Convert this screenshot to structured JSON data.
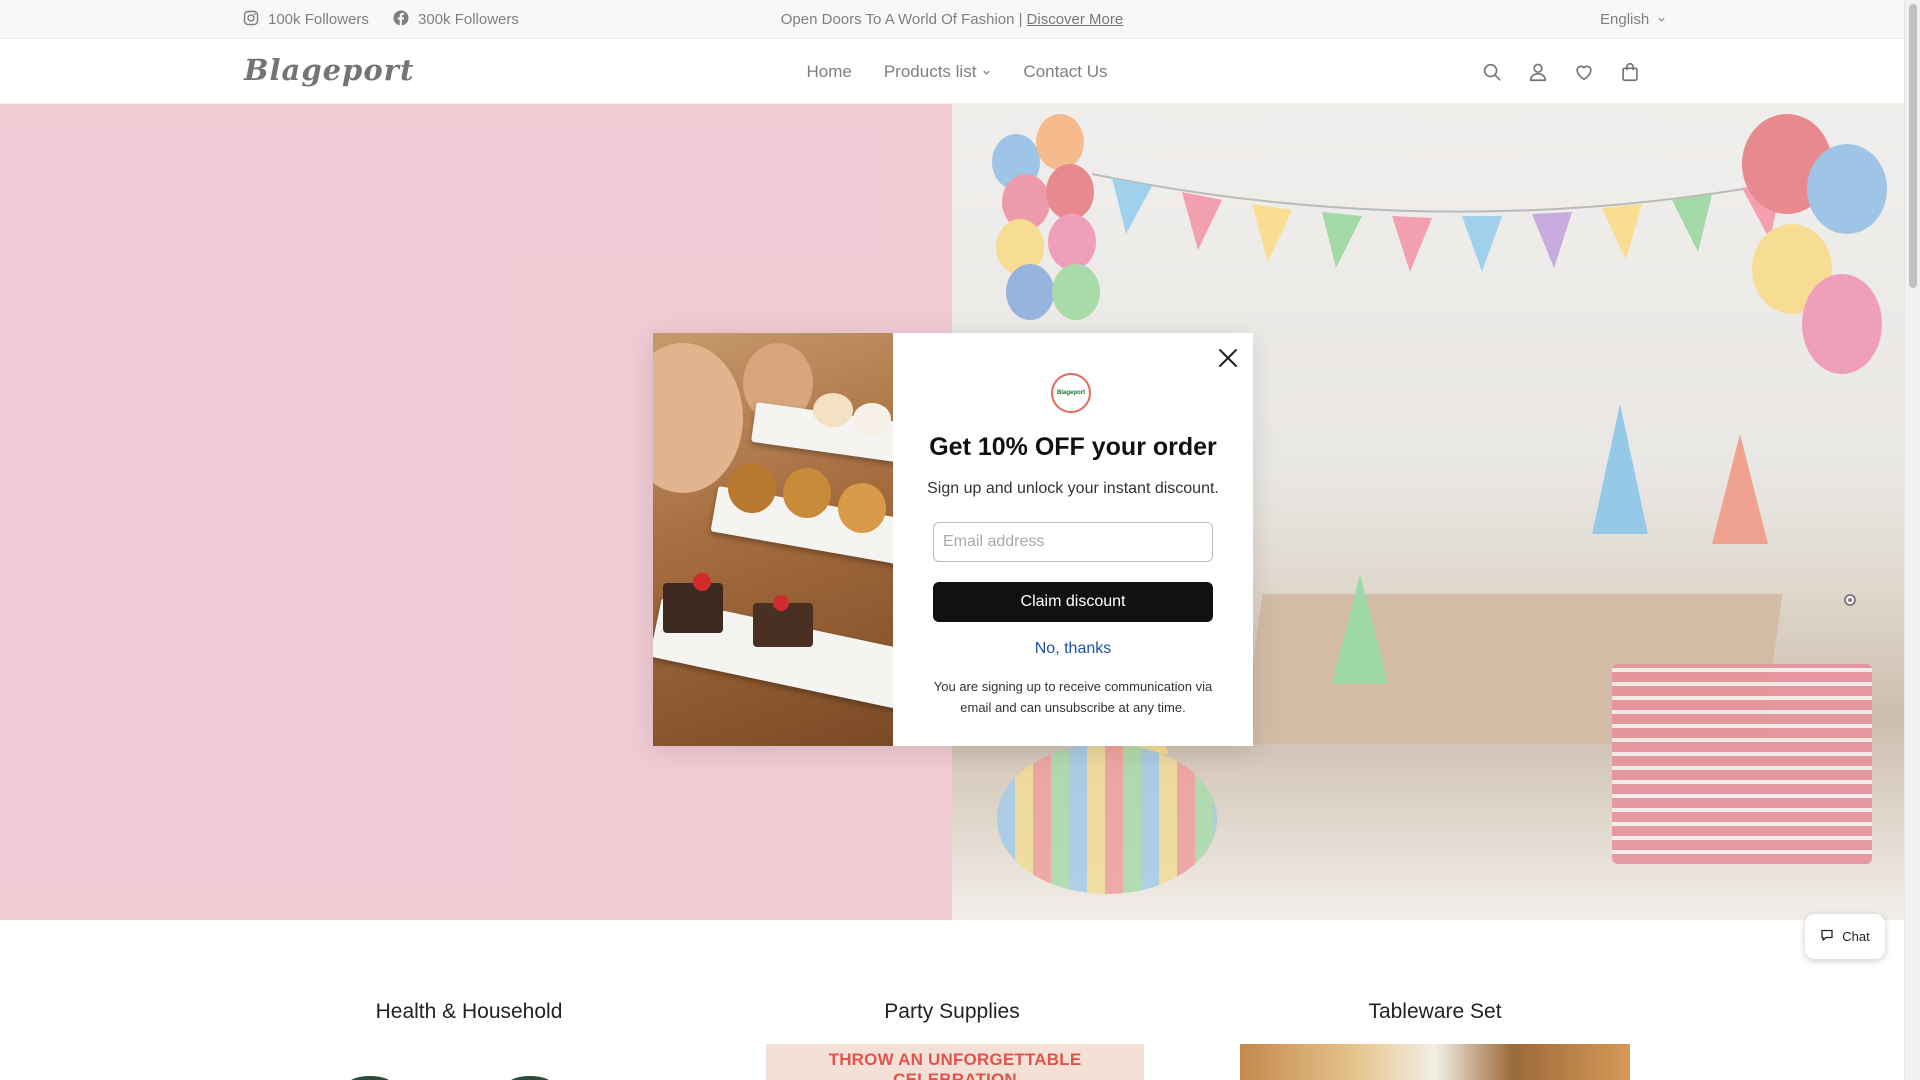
{
  "topbar": {
    "instagram_followers": "100k Followers",
    "facebook_followers": "300k Followers",
    "announcement_text": "Open Doors To A World Of Fashion |",
    "announcement_link": "Discover More",
    "language": "English"
  },
  "header": {
    "logo": "Blageport",
    "nav": [
      "Home",
      "Products list",
      "Contact Us"
    ],
    "icons": [
      "search-icon",
      "account-icon",
      "wishlist-icon",
      "cart-icon"
    ]
  },
  "popup": {
    "logo_text": "Blageport",
    "title": "Get 10% OFF your order",
    "subtitle": "Sign up and unlock your instant discount.",
    "email_placeholder": "Email address",
    "claim_button": "Claim discount",
    "no_thanks": "No, thanks",
    "disclaimer": "You are signing up to receive communication via email and can unsubscribe at any time."
  },
  "chat": {
    "label": "Chat"
  },
  "categories": [
    {
      "title": "Health & Household"
    },
    {
      "title": "Party Supplies",
      "banner_text": "THROW AN UNFORGETTABLE CELEBRATION"
    },
    {
      "title": "Tableware Set"
    }
  ],
  "colors": {
    "hero_pink": "#e7a6b6",
    "button_dark": "#111111",
    "link_blue": "#1f4fa8"
  }
}
